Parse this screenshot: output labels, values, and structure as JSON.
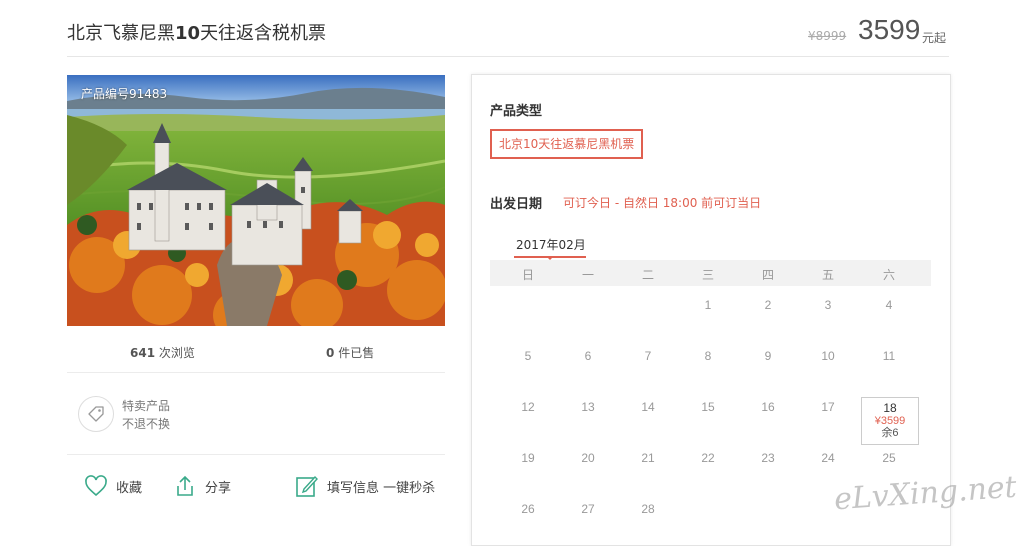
{
  "product": {
    "title_prefix": "北京飞慕尼黑",
    "title_days": "10",
    "title_suffix": "天往返含税机票",
    "price_old": "¥8999",
    "price_now": "3599",
    "price_unit": "元起",
    "code": "产品编号91483"
  },
  "stats": {
    "views_num": "641",
    "views_label": "次浏览",
    "sold_num": "0",
    "sold_label": "件已售"
  },
  "tag": {
    "line1": "特卖产品",
    "line2": "不退不换",
    "icon": "tag-icon"
  },
  "actions": {
    "favorite": "收藏",
    "share": "分享",
    "fill_info": "填写信息 一键秒杀"
  },
  "booking": {
    "type_label": "产品类型",
    "type_option": "北京10天往返慕尼黑机票",
    "date_label": "出发日期",
    "date_note": "可订今日 - 自然日 18:00 前可订当日",
    "month": "2017年02月",
    "weekdays": [
      "日",
      "一",
      "二",
      "三",
      "四",
      "五",
      "六"
    ],
    "days": {
      "d1": "1",
      "d2": "2",
      "d3": "3",
      "d4": "4",
      "d5": "5",
      "d6": "6",
      "d7": "7",
      "d8": "8",
      "d9": "9",
      "d10": "10",
      "d11": "11",
      "d12": "12",
      "d13": "13",
      "d14": "14",
      "d15": "15",
      "d16": "16",
      "d17": "17",
      "d19": "19",
      "d20": "20",
      "d21": "21",
      "d22": "22",
      "d23": "23",
      "d24": "24",
      "d25": "25",
      "d26": "26",
      "d27": "27",
      "d28": "28"
    },
    "selected": {
      "day": "18",
      "price": "¥3599",
      "remain": "余6"
    }
  },
  "watermark": "eLvXing.net",
  "colors": {
    "accent": "#e06050",
    "text": "#333333",
    "muted": "#999999"
  }
}
